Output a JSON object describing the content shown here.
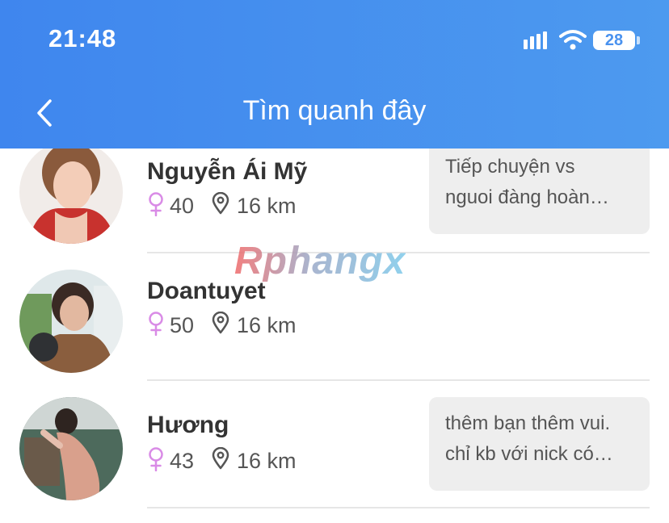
{
  "status_bar": {
    "time": "21:48",
    "battery": "28"
  },
  "header": {
    "title": "Tìm quanh đây",
    "back_icon": "chevron-left-icon",
    "background": "#4a92ef"
  },
  "watermark": "Rphangx",
  "users": [
    {
      "name": "Nguyễn Ái Mỹ",
      "age": "40",
      "distance": "16 km",
      "message_lines": [
        "Tiếp chuyện vs",
        "nguoi đàng hoàn…"
      ]
    },
    {
      "name": "Doantuyet",
      "age": "50",
      "distance": "16 km",
      "message_lines": []
    },
    {
      "name": "Hương",
      "age": "43",
      "distance": "16 km",
      "message_lines": [
        "thêm bạn thêm vui.",
        "chỉ kb với nick có…"
      ]
    }
  ],
  "colors": {
    "gender_female": "#d98be6",
    "bubble_bg": "#eeeeee",
    "text_primary": "#333333"
  }
}
